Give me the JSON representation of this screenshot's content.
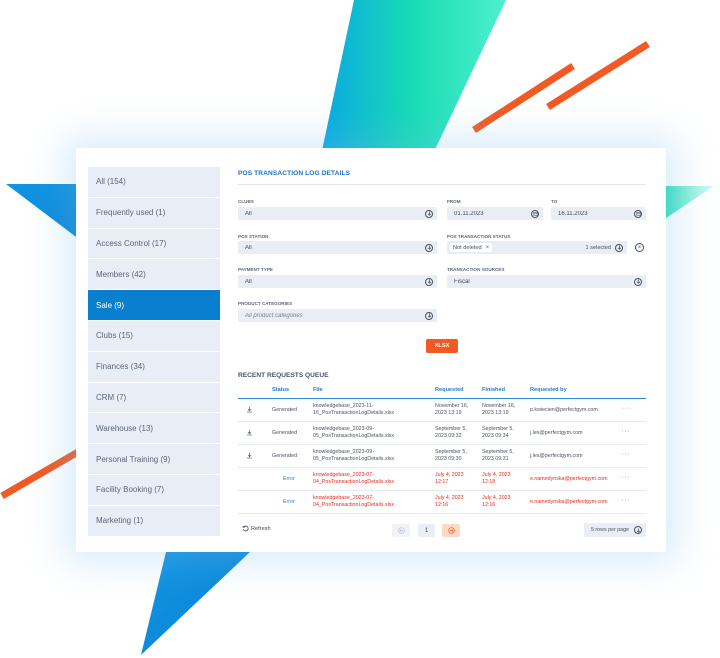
{
  "sidebar": {
    "items": [
      {
        "label": "All (154)"
      },
      {
        "label": "Frequently used (1)"
      },
      {
        "label": "Access Control (17)"
      },
      {
        "label": "Members (42)"
      },
      {
        "label": "Sale (9)",
        "active": true
      },
      {
        "label": "Clubs (15)"
      },
      {
        "label": "Finances (34)"
      },
      {
        "label": "CRM (7)"
      },
      {
        "label": "Warehouse (13)"
      },
      {
        "label": "Personal Training (9)"
      },
      {
        "label": "Facility Booking (7)"
      },
      {
        "label": "Marketing (1)"
      }
    ]
  },
  "report": {
    "title": "POS TRANSACTION LOG DETAILS",
    "clubs_label": "CLUBS",
    "clubs_value": "All",
    "from_label": "FROM",
    "from_value": "01.11.2023",
    "to_label": "TO",
    "to_value": "16.11.2023",
    "pos_station_label": "POS STATION",
    "pos_station_value": "All",
    "status_label": "POS TRANSACTION STATUS",
    "status_chip": "Not deleted",
    "status_chip_x": "×",
    "status_selected": "1 selected",
    "clear_icon": "×",
    "payment_label": "PAYMENT TYPE",
    "payment_value": "All",
    "sources_label": "TRANSACTION SOURCES",
    "sources_value": "Fiscal",
    "categories_label": "PRODUCT CATEGORIES",
    "categories_placeholder": "All product categories",
    "xlsx_label": "XLSX"
  },
  "queue": {
    "title": "RECENT REQUESTS QUEUE",
    "headers": {
      "status": "Status",
      "file": "File",
      "requested": "Requested",
      "finished": "Finished",
      "requested_by": "Requested by"
    },
    "rows": [
      {
        "status": "Generated",
        "file1": "knowledgebase_2023-11-",
        "file2": "16_PosTransactionLogDetails.xlsx",
        "req1": "November 16,",
        "req2": "2023 13:19",
        "fin1": "November 16,",
        "fin2": "2023 13:19",
        "by": "p.kwiecien@perfectgym.com",
        "error": false
      },
      {
        "status": "Generated",
        "file1": "knowledgebase_2023-09-",
        "file2": "05_PosTransactionLogDetails.xlsx",
        "req1": "September 5,",
        "req2": "2023 09:32",
        "fin1": "September 5,",
        "fin2": "2023 09:34",
        "by": "j.les@perfectgym.com",
        "error": false
      },
      {
        "status": "Generated",
        "file1": "knowledgebase_2023-09-",
        "file2": "05_PosTransactionLogDetails.xlsx",
        "req1": "September 5,",
        "req2": "2023 09:30",
        "fin1": "September 5,",
        "fin2": "2023 09:31",
        "by": "j.les@perfectgym.com",
        "error": false
      },
      {
        "status": "Error",
        "file1": "knowledgebase_2023-07-",
        "file2": "04_PosTransactionLogDetails.xlsx",
        "req1": "July 4, 2023",
        "req2": "12:17",
        "fin1": "July 4, 2023",
        "fin2": "12:18",
        "by": "e.namedynska@perfectgym.com",
        "error": true
      },
      {
        "status": "Error",
        "file1": "knowledgebase_2023-07-",
        "file2": "04_PosTransactionLogDetails.xlsx",
        "req1": "July 4, 2023",
        "req2": "12:16",
        "fin1": "July 4, 2023",
        "fin2": "12:16",
        "by": "e.namedynska@perfectgym.com",
        "error": true
      }
    ],
    "more_label": "···",
    "refresh_label": "Refresh",
    "page": "1",
    "rows_per_page": "5 rows per page"
  },
  "colors": {
    "accent": "#0a7fd0",
    "orange": "#f15a22",
    "error": "#e8281d",
    "teal": "#19dcb4"
  }
}
